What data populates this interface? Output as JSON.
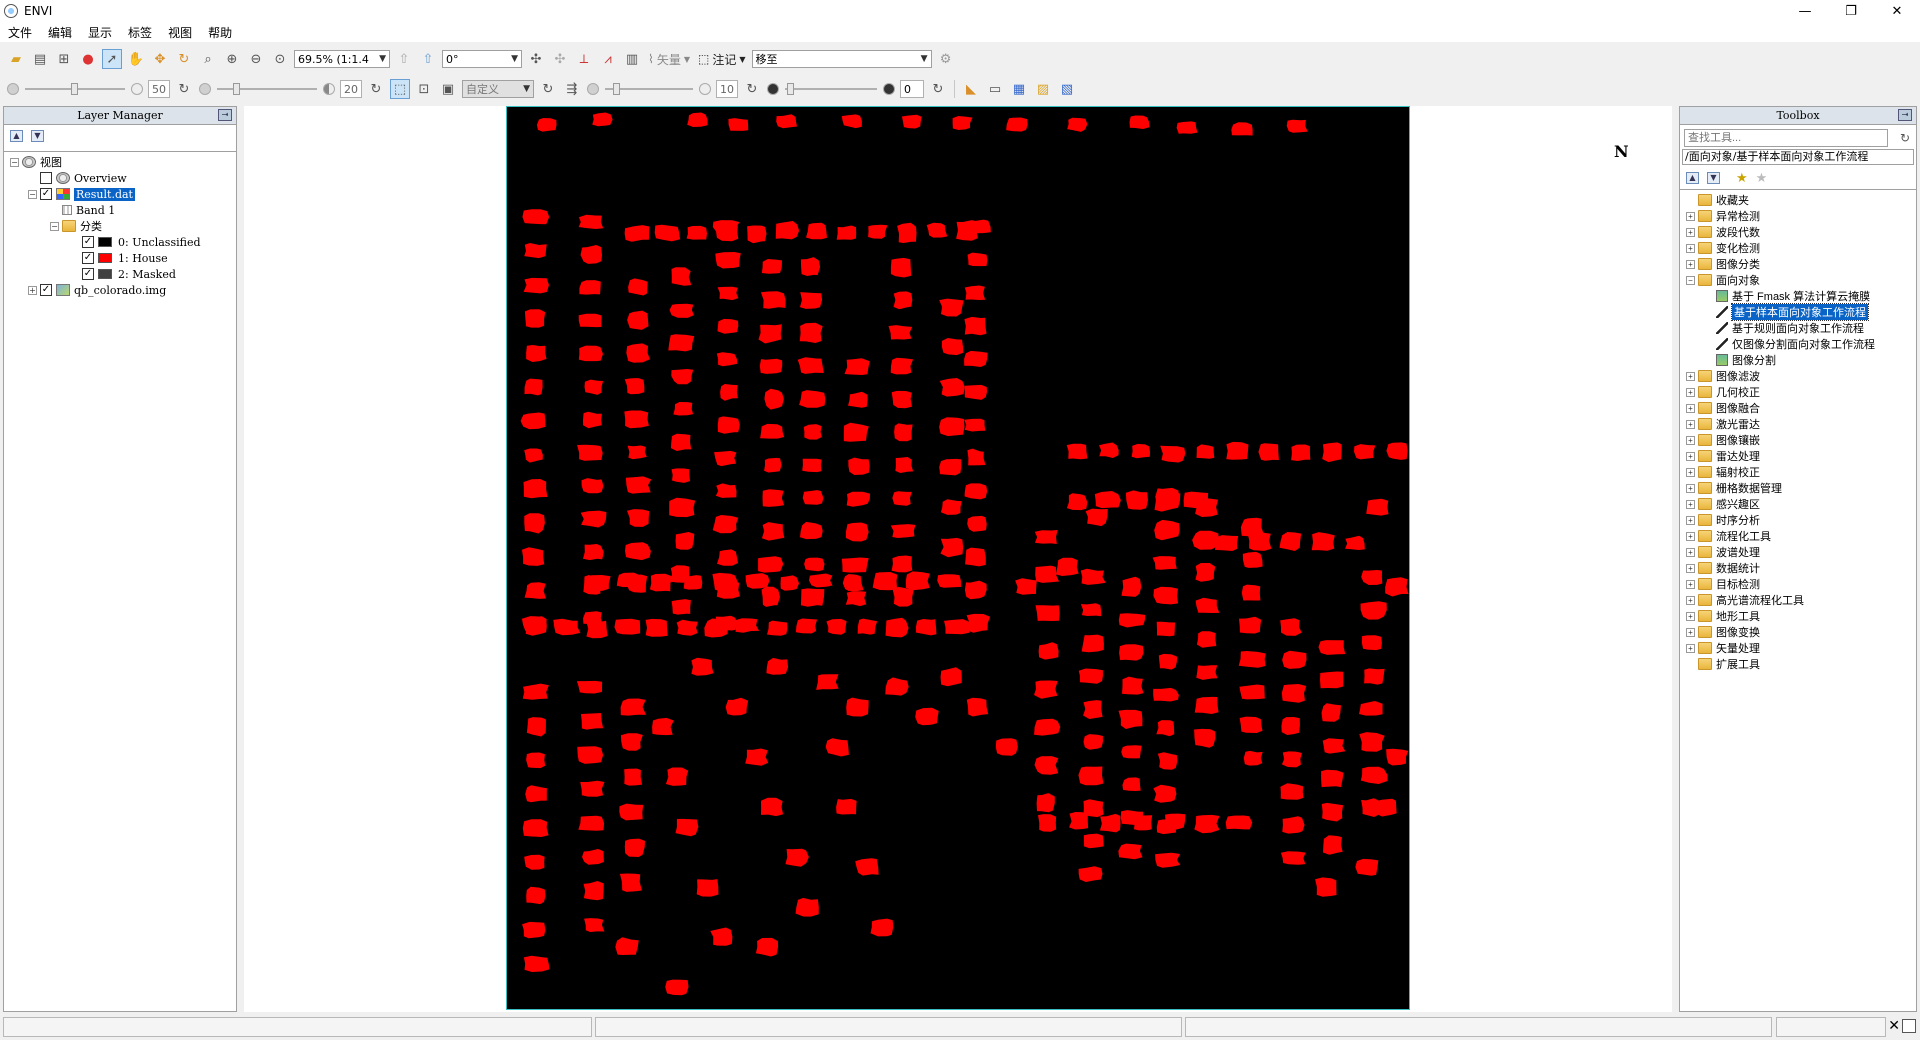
{
  "window": {
    "title": "ENVI",
    "minimize": "—",
    "restore": "❐",
    "close": "✕"
  },
  "menu": [
    "文件",
    "编辑",
    "显示",
    "标签",
    "视图",
    "帮助"
  ],
  "toolbar1": {
    "zoom_value": "69.5% (1:1.4",
    "rotation_value": "0°",
    "vector_label": "矢量",
    "annotation_label": "注记",
    "goto_value": "移至"
  },
  "toolbar2": {
    "brightness_value": "50",
    "contrast_value": "20",
    "stretch_value": "自定义",
    "sharpen_value": "10",
    "transparency_value": "0"
  },
  "layer_manager": {
    "title": "Layer Manager",
    "root_label": "视图",
    "overview_label": "Overview",
    "result_label": "Result.dat",
    "band_label": "Band 1",
    "classes_folder": "分类",
    "classes": [
      {
        "label": "0: Unclassified",
        "color": "#000000"
      },
      {
        "label": "1: House",
        "color": "#ff0000"
      },
      {
        "label": "2: Masked",
        "color": "#404040"
      }
    ],
    "image_label": "qb_colorado.img"
  },
  "image": {
    "background": "#000000",
    "class_color": "#ff0000"
  },
  "north_arrow": "N",
  "toolbox": {
    "title": "Toolbox",
    "search_placeholder": "查找工具...",
    "path": "/面向对象/基于样本面向对象工作流程",
    "folders_before": [
      "收藏夹",
      "异常检测",
      "波段代数",
      "变化检测",
      "图像分类"
    ],
    "open_folder": "面向对象",
    "open_children": [
      {
        "label": "基于 Fmask 算法计算云掩膜",
        "selected": false
      },
      {
        "label": "基于样本面向对象工作流程",
        "selected": true
      },
      {
        "label": "基于规则面向对象工作流程",
        "selected": false
      },
      {
        "label": "仅图像分割面向对象工作流程",
        "selected": false
      },
      {
        "label": "图像分割",
        "selected": false
      }
    ],
    "folders_after": [
      "图像滤波",
      "几何校正",
      "图像融合",
      "激光雷达",
      "图像镶嵌",
      "雷达处理",
      "辐射校正",
      "栅格数据管理",
      "感兴趣区",
      "时序分析",
      "流程化工具",
      "波谱处理",
      "数据统计",
      "目标检测",
      "高光谱流程化工具",
      "地形工具",
      "图像变换",
      "矢量处理",
      "扩展工具"
    ]
  }
}
